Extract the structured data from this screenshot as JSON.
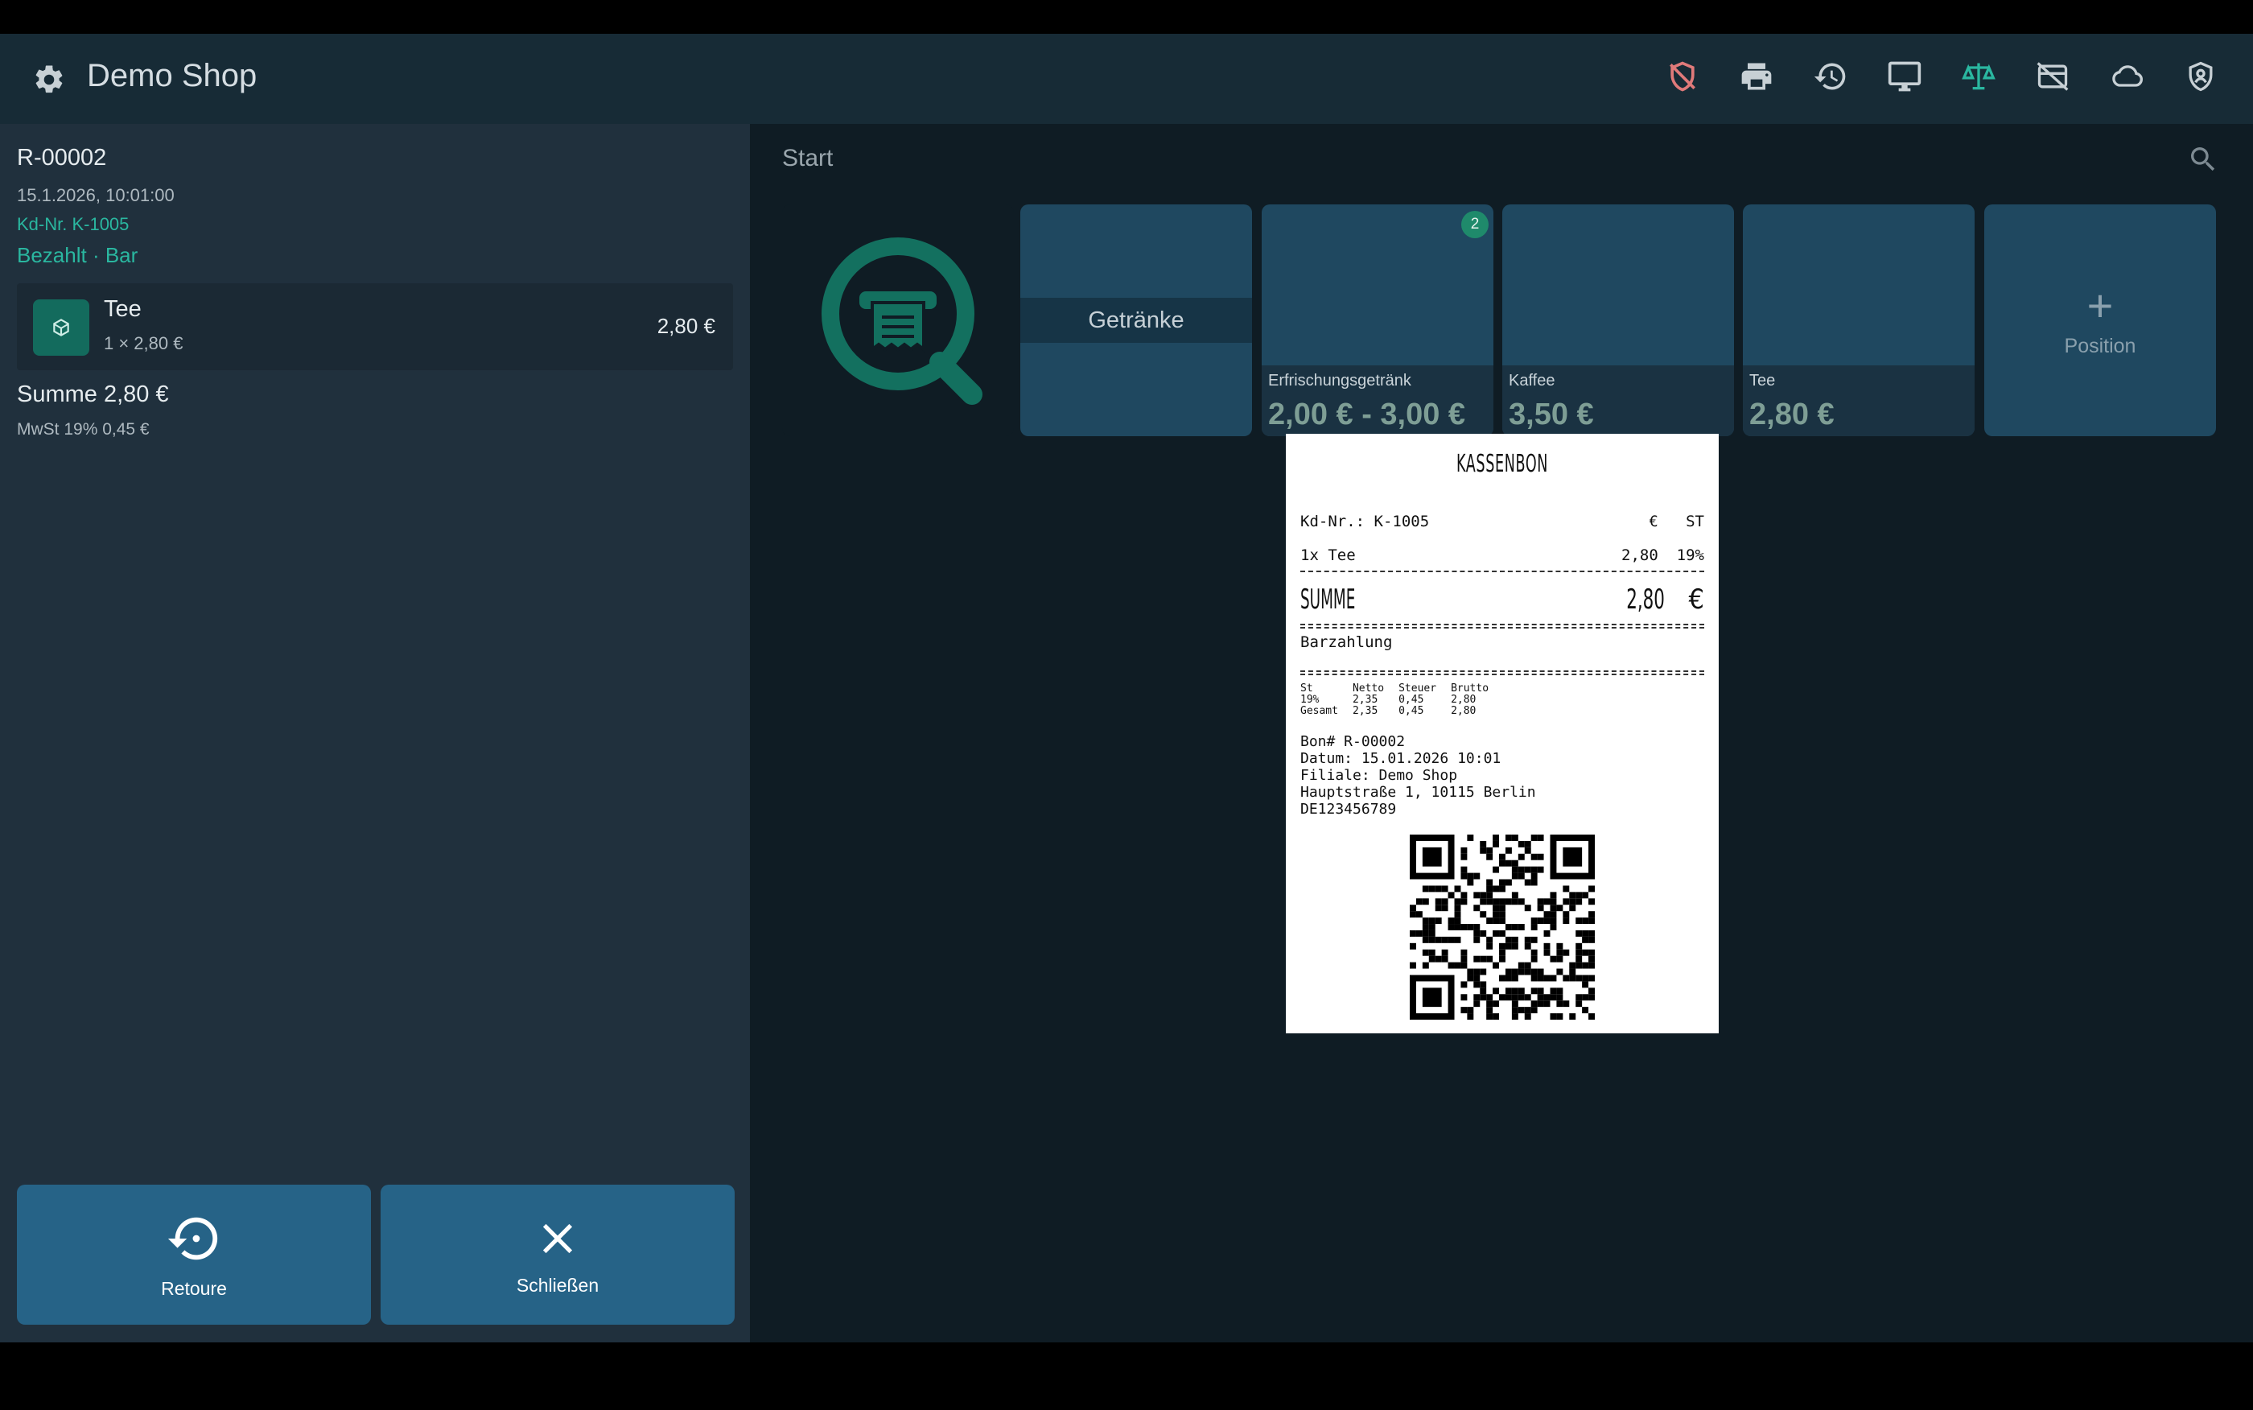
{
  "app": {
    "title": "Demo Shop"
  },
  "toolbar": {
    "icons": [
      "shield-off-icon",
      "printer-icon",
      "history-icon",
      "monitor-icon",
      "scale-icon",
      "card-off-icon",
      "cloud-icon",
      "shield-user-icon"
    ],
    "accent": "#2ab7a0",
    "warn": "#e07a7a"
  },
  "invoice": {
    "number": "R-00002",
    "date": "15.1.2026, 10:01:00",
    "customer": "Kd-Nr. K-1005",
    "status": "Bezahlt · Bar",
    "items": [
      {
        "name": "Tee",
        "qty": "1 × 2,80 €",
        "price": "2,80 €"
      }
    ],
    "sum": "Summe 2,80 €",
    "vat": "MwSt 19% 0,45 €"
  },
  "actions": {
    "retoure": "Retoure",
    "close": "Schließen"
  },
  "catalog": {
    "breadcrumb": "Start",
    "category": "Getränke",
    "products": [
      {
        "name": "Erfrischungsgetränk",
        "price": "2,00 € - 3,00 €",
        "count": "2"
      },
      {
        "name": "Kaffee",
        "price": "3,50 €",
        "count": ""
      },
      {
        "name": "Tee",
        "price": "2,80 €",
        "count": ""
      }
    ],
    "add_label": "Position",
    "add_symbol": "+"
  },
  "receipt": {
    "title": "KASSENBON",
    "customer": "Kd-Nr.: K-1005",
    "col_currency": "€",
    "col_tax": "ST",
    "line": "1x Tee",
    "line_price": "2,80",
    "line_tax": "19%",
    "sum_label": "SUMME",
    "sum_value": "2,80",
    "sum_currency": "€",
    "payment": "Barzahlung",
    "tax_header": [
      "St",
      "Netto",
      "Steuer",
      "Brutto"
    ],
    "tax_rows": [
      [
        "19%",
        "2,35",
        "0,45",
        "2,80"
      ],
      [
        "Gesamt",
        "2,35",
        "0,45",
        "2,80"
      ]
    ],
    "bon": "Bon# R-00002",
    "datum": "Datum: 15.01.2026 10:01",
    "filiale": "Filiale: Demo Shop",
    "address": "Hauptstraße 1, 10115 Berlin",
    "vat_id": "DE123456789"
  }
}
